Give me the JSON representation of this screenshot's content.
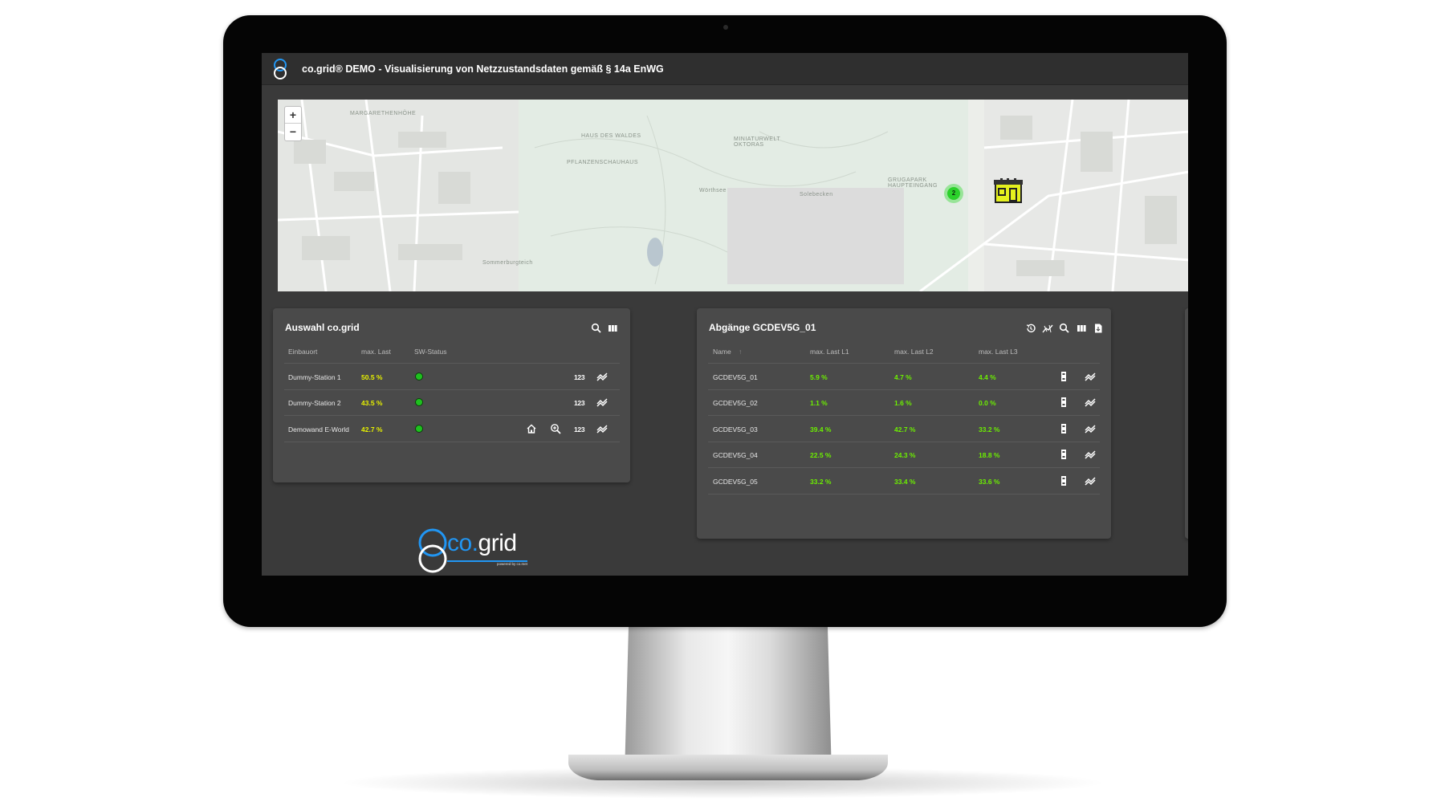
{
  "app": {
    "title": "co.grid® DEMO - Visualisierung von Netzzustandsdaten gemäß § 14a EnWG"
  },
  "map": {
    "zoom_in": "+",
    "zoom_out": "−",
    "labels": [
      "MARGARETHENHÖHE",
      "HAUS DES WALDES",
      "MINIATURWELT OKTORAS",
      "PFLANZENSCHAUHAUS",
      "GRUGAPARK HAUPTEINGANG",
      "Wörthsee",
      "Solebecken",
      "Sommerburgteich"
    ],
    "cluster_count": "2"
  },
  "left_panel": {
    "title": "Auswahl co.grid",
    "columns": [
      "Einbauort",
      "max. Last",
      "SW-Status"
    ],
    "rows": [
      {
        "name": "Dummy-Station 1",
        "load": "50.5 %",
        "status": "green"
      },
      {
        "name": "Dummy-Station 2",
        "load": "43.5 %",
        "status": "green"
      },
      {
        "name": "Demowand E-World",
        "load": "42.7 %",
        "status": "green"
      }
    ],
    "badge": "123"
  },
  "right_panel": {
    "title": "Abgänge GCDEV5G_01",
    "columns": [
      "Name",
      "max. Last L1",
      "max. Last L2",
      "max. Last L3"
    ],
    "sort_indicator": "↑",
    "rows": [
      {
        "name": "GCDEV5G_01",
        "l1": "5.9 %",
        "l2": "4.7 %",
        "l3": "4.4 %"
      },
      {
        "name": "GCDEV5G_02",
        "l1": "1.1 %",
        "l2": "1.6 %",
        "l3": "0.0 %"
      },
      {
        "name": "GCDEV5G_03",
        "l1": "39.4 %",
        "l2": "42.7 %",
        "l3": "33.2 %"
      },
      {
        "name": "GCDEV5G_04",
        "l1": "22.5 %",
        "l2": "24.3 %",
        "l3": "18.8 %"
      },
      {
        "name": "GCDEV5G_05",
        "l1": "33.2 %",
        "l2": "33.4 %",
        "l3": "33.6 %"
      }
    ]
  },
  "brand": {
    "co": "co.",
    "grid": "grid",
    "sub": "powered by co.met"
  },
  "colors": {
    "load_yellow": "#e6f000",
    "load_green": "#6cf000",
    "status_green": "#1fc01f",
    "brand_blue": "#2196f3"
  }
}
